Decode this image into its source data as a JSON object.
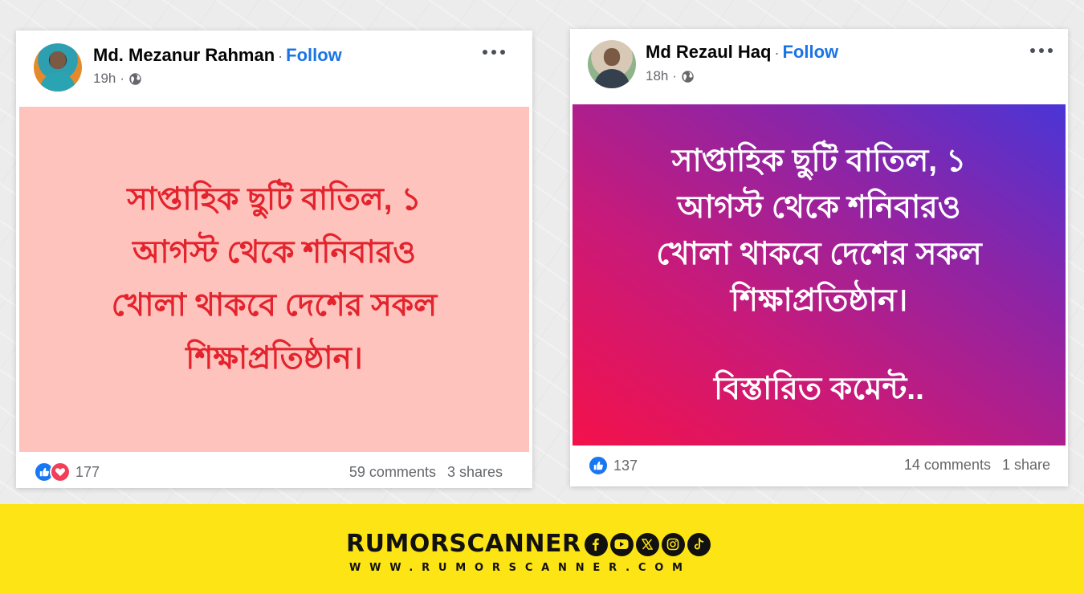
{
  "posts": [
    {
      "author": "Md. Mezanur Rahman",
      "separator": "·",
      "follow_label": "Follow",
      "time": "19h",
      "time_separator": "·",
      "privacy_icon": "globe-icon",
      "text": "সাপ্তাহিক ছুটি বাতিল, ১\nআগস্ট থেকে শনিবারও\nখোলা থাকবে দেশের সকল\nশিক্ষাপ্রতিষ্ঠান।",
      "reaction_icons": [
        "like-icon",
        "love-icon"
      ],
      "reaction_count": "177",
      "comments": "59 comments",
      "shares": "3 shares",
      "background": "#ffc3bd",
      "text_color": "#e3232d"
    },
    {
      "author": "Md Rezaul Haq",
      "separator": "·",
      "follow_label": "Follow",
      "time": "18h",
      "time_separator": "·",
      "privacy_icon": "globe-icon",
      "text": "সাপ্তাহিক ছুটি বাতিল, ১\nআগস্ট থেকে শনিবারও\nখোলা থাকবে দেশের সকল\nশিক্ষাপ্রতিষ্ঠান।",
      "extra_text": "বিস্তারিত কমেন্ট..",
      "reaction_icons": [
        "like-icon"
      ],
      "reaction_count": "137",
      "comments": "14 comments",
      "shares": "1 share",
      "background": [
        "#f4114a",
        "#8a25a8",
        "#4a35d6"
      ],
      "text_color": "#ffffff"
    }
  ],
  "branding": {
    "name": "RUMORSCANNER",
    "url": "WWW.RUMORSCANNER.COM",
    "social_icons": [
      "facebook-icon",
      "youtube-icon",
      "x-icon",
      "instagram-icon",
      "tiktok-icon"
    ],
    "background": "#fde414"
  },
  "colors": {
    "follow": "#1b74e4",
    "like": "#1877f2",
    "love": "#f33e58"
  }
}
